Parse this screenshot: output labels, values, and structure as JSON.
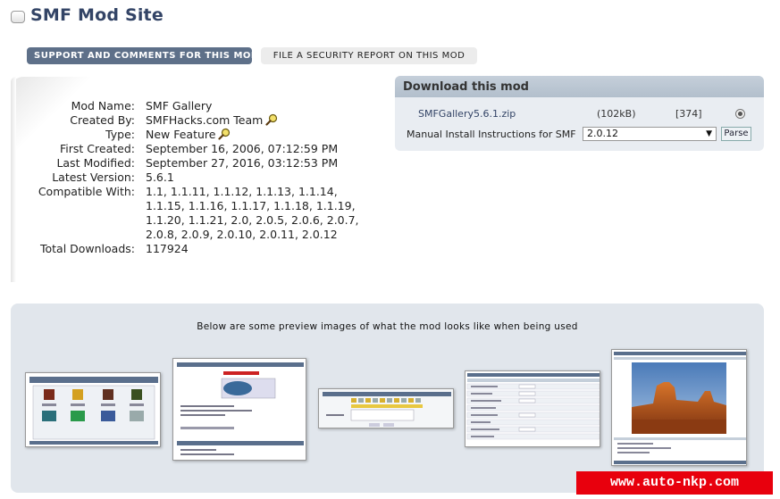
{
  "site": {
    "title": "SMF Mod Site"
  },
  "buttons": {
    "support": "SUPPORT AND COMMENTS FOR THIS MOD",
    "security": "FILE A SECURITY REPORT ON THIS MOD"
  },
  "details": [
    {
      "label": "Mod Name:",
      "value": "SMF Gallery"
    },
    {
      "label": "Created By:",
      "value": "SMFHacks.com Team"
    },
    {
      "label": "Type:",
      "value": "New Feature"
    },
    {
      "label": "First Created:",
      "value": "September 16, 2006, 07:12:59 PM"
    },
    {
      "label": "Last Modified:",
      "value": "September 27, 2016, 03:12:53 PM"
    },
    {
      "label": "Latest Version:",
      "value": "5.6.1"
    },
    {
      "label": "Compatible With:",
      "value": "1.1, 1.1.11, 1.1.12, 1.1.13, 1.1.14, 1.1.15, 1.1.16, 1.1.17, 1.1.18, 1.1.19, 1.1.20, 1.1.21, 2.0, 2.0.5, 2.0.6, 2.0.7, 2.0.8, 2.0.9, 2.0.10, 2.0.11, 2.0.12"
    },
    {
      "label": "Total Downloads:",
      "value": "117924"
    }
  ],
  "download": {
    "title": "Download this mod",
    "file": "SMFGallery5.6.1.zip",
    "size": "(102kB)",
    "count": "[374]",
    "manual_label": "Manual Install Instructions for SMF",
    "selected_version": "2.0.12",
    "parse_label": "Parse"
  },
  "preview": {
    "text": "Below are some preview images of what the mod looks like when being used"
  },
  "watermark": "www.auto-nkp.com",
  "icons": {
    "search": "magnifier-icon"
  },
  "colors": {
    "accent": "#334466",
    "button": "#5e7089",
    "watermark": "#e8000d"
  }
}
